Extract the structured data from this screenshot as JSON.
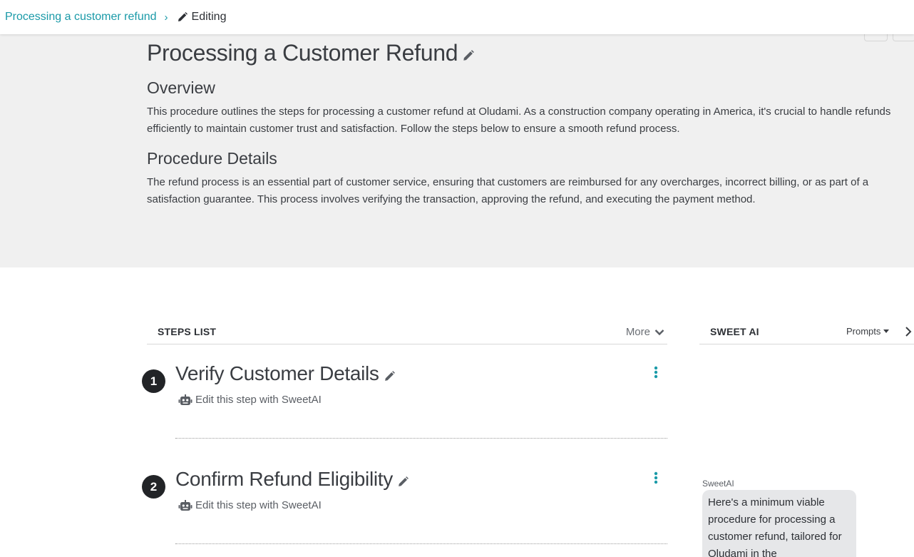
{
  "breadcrumb": {
    "link_label": "Processing a customer refund",
    "separator": "›",
    "current_label": "Editing"
  },
  "header": {
    "title": "Processing a Customer Refund",
    "overview_heading": "Overview",
    "overview_text": "This procedure outlines the steps for processing a customer refund at Oludami. As a construction company operating in America, it's crucial to handle refunds efficiently to maintain customer trust and satisfaction. Follow the steps below to ensure a smooth refund process.",
    "details_heading": "Procedure Details",
    "details_text": "The refund process is an essential part of customer service, ensuring that customers are reimbursed for any overcharges, incorrect billing, or as part of a satisfaction guarantee. This process involves verifying the transaction, approving the refund, and executing the payment method."
  },
  "steps_list": {
    "heading": "STEPS LIST",
    "more_label": "More",
    "steps": [
      {
        "number": "1",
        "title": "Verify Customer Details",
        "edit_label": "Edit this step with SweetAI"
      },
      {
        "number": "2",
        "title": "Confirm Refund Eligibility",
        "edit_label": "Edit this step with SweetAI"
      }
    ]
  },
  "sweet_ai": {
    "heading": "SWEET AI",
    "prompts_label": "Prompts",
    "message_sender": "SweetAI",
    "message_text": "Here's a minimum viable procedure for processing a customer refund, tailored for Oludami in the"
  },
  "colors": {
    "accent": "#1a9aa8",
    "header_bg": "#f0f0f0",
    "step_badge": "#222427",
    "bubble_bg": "#e6e7e9"
  },
  "icons": {
    "breadcrumb_edit": "pencil-icon",
    "title_edit": "pencil-icon",
    "step_menu": "kebab-icon",
    "step_ai": "robot-icon",
    "more_toggle": "chevron-down-icon",
    "panel_collapse": "chevron-right-icon"
  }
}
